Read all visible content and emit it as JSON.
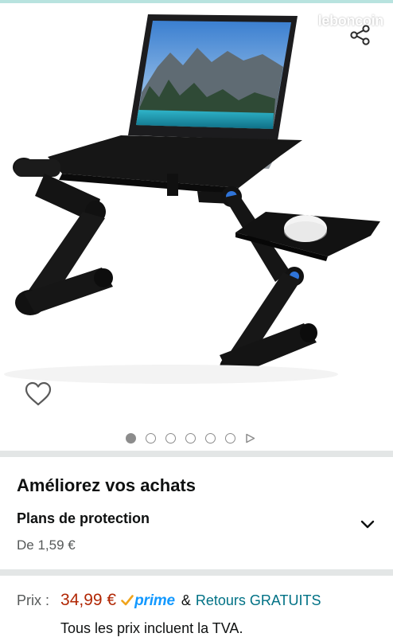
{
  "watermark": {
    "text": "leboncoin"
  },
  "icons": {
    "share": "share-icon",
    "favorite": "heart-outline-icon",
    "expand": "chevron-down-icon",
    "prime_check": "check-icon"
  },
  "carousel": {
    "total_dots": 6,
    "active_index": 0,
    "has_video_indicator": true
  },
  "upgrade_section": {
    "title": "Améliorez vos achats",
    "plans_title": "Plans de protection",
    "plans_price": "De 1,59 €"
  },
  "pricing": {
    "label": "Prix :",
    "price": "34,99 €",
    "prime": "prime",
    "and": "&",
    "returns": "Retours GRATUITS",
    "tva_note": "Tous les prix incluent la TVA."
  },
  "colors": {
    "price": "#b12704",
    "link": "#007185",
    "prime": "#1399ff",
    "divider": "#e3e6e6",
    "top_strip": "#b8e3df"
  }
}
